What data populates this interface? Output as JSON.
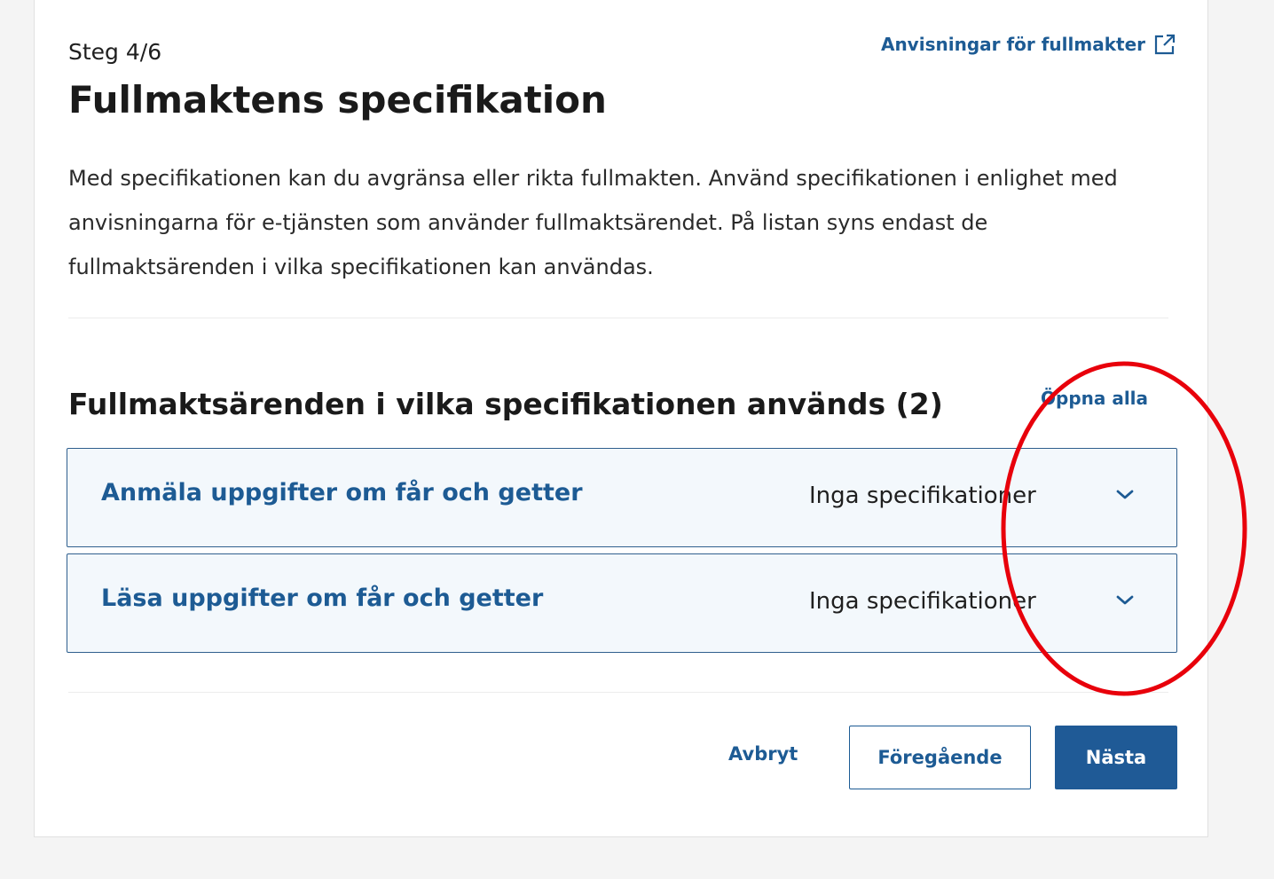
{
  "header": {
    "step": "Steg 4/6",
    "guide_link": "Anvisningar för fullmakter",
    "title": "Fullmaktens specifikation"
  },
  "intro": "Med specifikationen kan du avgränsa eller rikta fullmakten. Använd specifikationen i enlighet med anvisningarna för e-tjänsten som använder fullmaktsärendet. På listan syns endast de fullmaktsärenden i vilka specifikationen kan användas.",
  "section": {
    "title": "Fullmaktsärenden i vilka specifikationen används (2)",
    "open_all": "Öppna alla"
  },
  "items": [
    {
      "label": "Anmäla uppgifter om får och getter",
      "status": "Inga specifikationer"
    },
    {
      "label": "Läsa uppgifter om får och getter",
      "status": "Inga specifikationer"
    }
  ],
  "actions": {
    "cancel": "Avbryt",
    "previous": "Föregående",
    "next": "Nästa"
  },
  "colors": {
    "accent": "#1d5b94",
    "primary_button": "#1f5a96",
    "accordion_bg": "#f3f8fc",
    "annotation": "#e8000b"
  },
  "icons": {
    "guide_link": "external-link-icon",
    "accordion": "chevron-down-icon"
  }
}
